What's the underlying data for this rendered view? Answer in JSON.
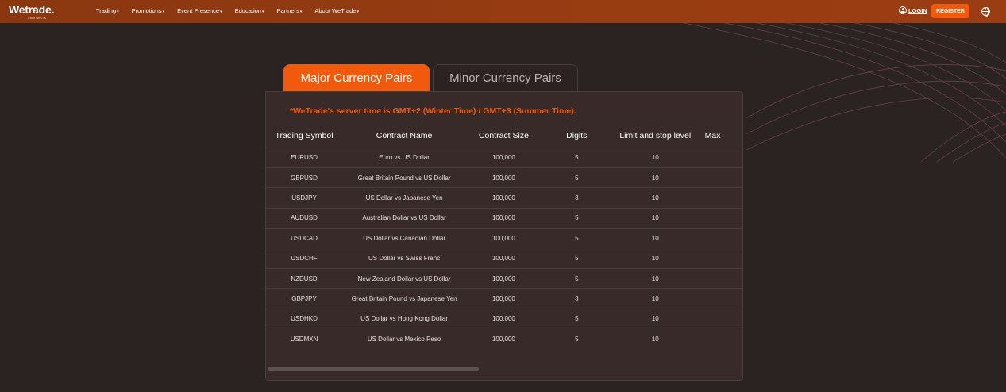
{
  "header": {
    "logo": "Wetrade.",
    "logo_tagline": "Trade with us",
    "nav": [
      "Trading",
      "Promotions",
      "Event Presence",
      "Education",
      "Partners",
      "About WeTrade"
    ],
    "login_label": "LOGIN",
    "register_label": "REGISTER",
    "icons": [
      "user-icon",
      "globe-icon"
    ]
  },
  "tabs": [
    {
      "label": "Major Currency Pairs",
      "active": true
    },
    {
      "label": "Minor Currency Pairs",
      "active": false
    }
  ],
  "notice": "*WeTrade's server time is GMT+2 (Winter Time) / GMT+3 (Summer Time).",
  "table": {
    "columns": [
      "Trading Symbol",
      "Contract Name",
      "Contract Size",
      "Digits",
      "Limit and stop level",
      "Max"
    ],
    "rows": [
      [
        "EURUSD",
        "Euro vs US Dollar",
        "100,000",
        "5",
        "10",
        ""
      ],
      [
        "GBPUSD",
        "Great Britain Pound vs US Dollar",
        "100,000",
        "5",
        "10",
        ""
      ],
      [
        "USDJPY",
        "US Dollar vs Japanese Yen",
        "100,000",
        "3",
        "10",
        ""
      ],
      [
        "AUDUSD",
        "Australian Dollar vs US Dollar",
        "100,000",
        "5",
        "10",
        ""
      ],
      [
        "USDCAD",
        "US Dollar vs Canadian Dollar",
        "100,000",
        "5",
        "10",
        ""
      ],
      [
        "USDCHF",
        "US Dollar vs Swiss Franc",
        "100,000",
        "5",
        "10",
        ""
      ],
      [
        "NZDUSD",
        "New Zealand Dollar vs US Dollar",
        "100,000",
        "5",
        "10",
        ""
      ],
      [
        "GBPJPY",
        "Great Britain Pound vs Japanese Yen",
        "100,000",
        "3",
        "10",
        ""
      ],
      [
        "USDHKD",
        "US Dollar vs Hong Kong Dollar",
        "100,000",
        "5",
        "10",
        ""
      ],
      [
        "USDMXN",
        "US Dollar vs Mexico Peso",
        "100,000",
        "5",
        "10",
        ""
      ]
    ]
  },
  "colors": {
    "accent": "#f15a0d",
    "header_bg": "#983c12",
    "page_bg": "#2b2222",
    "panel_bg": "#372a29"
  }
}
